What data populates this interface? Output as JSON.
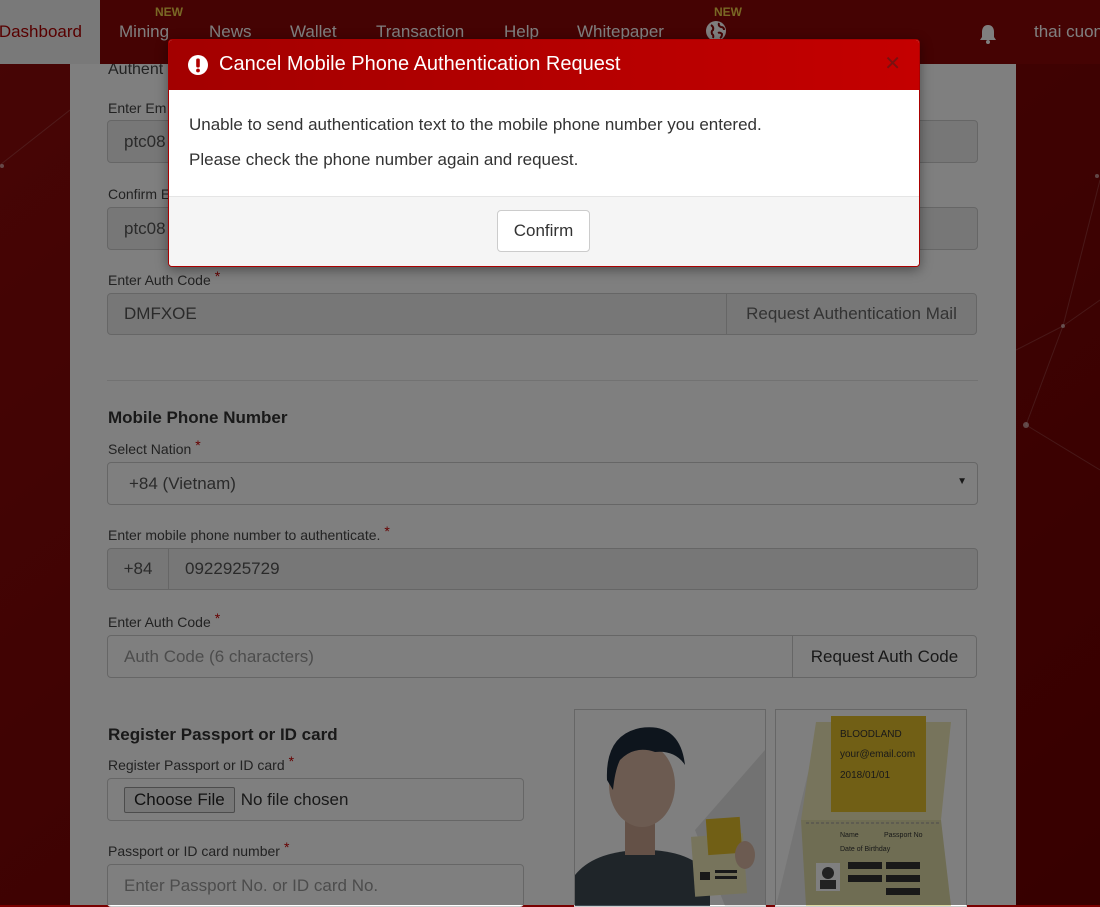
{
  "nav": {
    "items": [
      {
        "label": "Dashboard",
        "active": true
      },
      {
        "label": "Mining",
        "badge": "NEW"
      },
      {
        "label": "News"
      },
      {
        "label": "Wallet"
      },
      {
        "label": "Transaction"
      },
      {
        "label": "Help"
      },
      {
        "label": "Whitepaper"
      }
    ],
    "globe_badge": "NEW",
    "user_name": "thai cuon"
  },
  "form": {
    "email_section_title": "Authent",
    "email_label": "Enter Em",
    "email_value": "ptc08",
    "confirm_email_label": "Confirm E",
    "confirm_email_value": "ptc08",
    "email_auth_label": "Enter Auth Code",
    "email_auth_value": "DMFXOE",
    "request_mail_button": "Request Authentication Mail",
    "phone_section_title": "Mobile Phone Number",
    "nation_label": "Select Nation",
    "nation_value": "+84 (Vietnam)",
    "phone_label": "Enter mobile phone number to authenticate.",
    "phone_prefix": "+84",
    "phone_value": "0922925729",
    "phone_auth_label": "Enter Auth Code",
    "phone_auth_placeholder": "Auth Code (6 characters)",
    "request_code_button": "Request Auth Code",
    "passport_section_title": "Register Passport or ID card",
    "passport_file_label": "Register Passport or ID card",
    "choose_file_button": "Choose File",
    "no_file_text": "No file chosen",
    "passport_number_label": "Passport or ID card number",
    "passport_number_placeholder": "Enter Passport No. or ID card No.",
    "required_mark": "*"
  },
  "illustration": {
    "card_brand": "BLOODLAND",
    "card_email": "your@email.com",
    "card_date": "2018/01/01",
    "card_name_label": "Name",
    "card_passport_label": "Passport No",
    "card_birth_label": "Date of Birthday"
  },
  "modal": {
    "title": "Cancel Mobile Phone Authentication Request",
    "close_symbol": "✕",
    "line1": "Unable to send authentication text to the mobile phone number you entered.",
    "line2": "Please check the phone number again and request.",
    "confirm_label": "Confirm"
  },
  "colors": {
    "brand_red": "#8a0606",
    "modal_header": "#b30000",
    "badge_yellow": "#f2d14a"
  }
}
